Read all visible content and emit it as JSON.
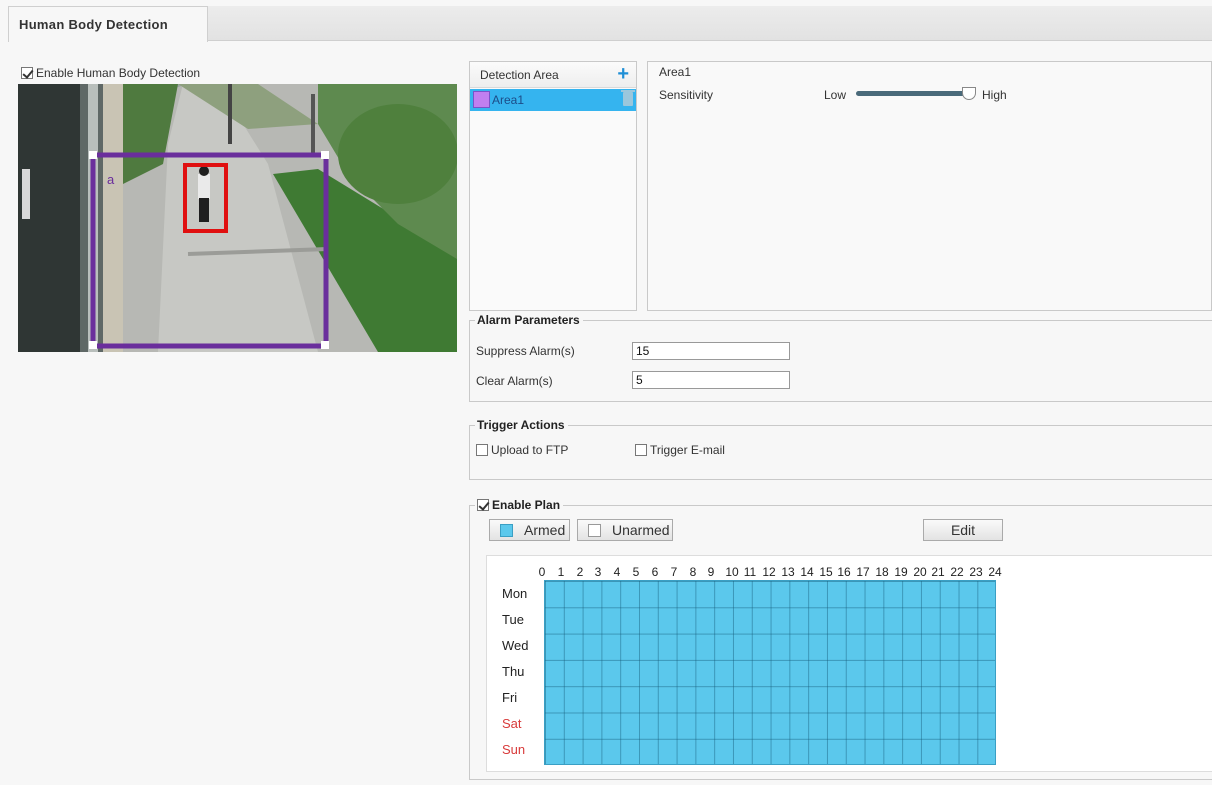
{
  "tab": {
    "label": "Human Body Detection"
  },
  "enable_detection": {
    "label": "Enable Human Body Detection",
    "checked": true
  },
  "video": {
    "area_label": "a"
  },
  "detection_area": {
    "header": "Detection Area",
    "items": [
      {
        "label": "Area1",
        "color": "#c07ff0"
      }
    ]
  },
  "area_detail": {
    "name": "Area1",
    "sensitivity_label": "Sensitivity",
    "low_label": "Low",
    "high_label": "High",
    "sensitivity_level": 0.95
  },
  "alarm_parameters": {
    "legend": "Alarm Parameters",
    "suppress_label": "Suppress Alarm(s)",
    "suppress_value": "15",
    "clear_label": "Clear Alarm(s)",
    "clear_value": "5"
  },
  "trigger_actions": {
    "legend": "Trigger Actions",
    "upload_ftp": "Upload to FTP",
    "trigger_email": "Trigger E-mail"
  },
  "plan": {
    "legend": "Enable Plan",
    "enabled": true,
    "armed_label": "Armed",
    "unarmed_label": "Unarmed",
    "edit_label": "Edit",
    "armed_color": "#5bc8ec",
    "hours": [
      "0",
      "1",
      "2",
      "3",
      "4",
      "5",
      "6",
      "7",
      "8",
      "9",
      "10",
      "11",
      "12",
      "13",
      "14",
      "15",
      "16",
      "17",
      "18",
      "19",
      "20",
      "21",
      "22",
      "23",
      "24"
    ],
    "days": [
      "Mon",
      "Tue",
      "Wed",
      "Thu",
      "Fri",
      "Sat",
      "Sun"
    ]
  }
}
